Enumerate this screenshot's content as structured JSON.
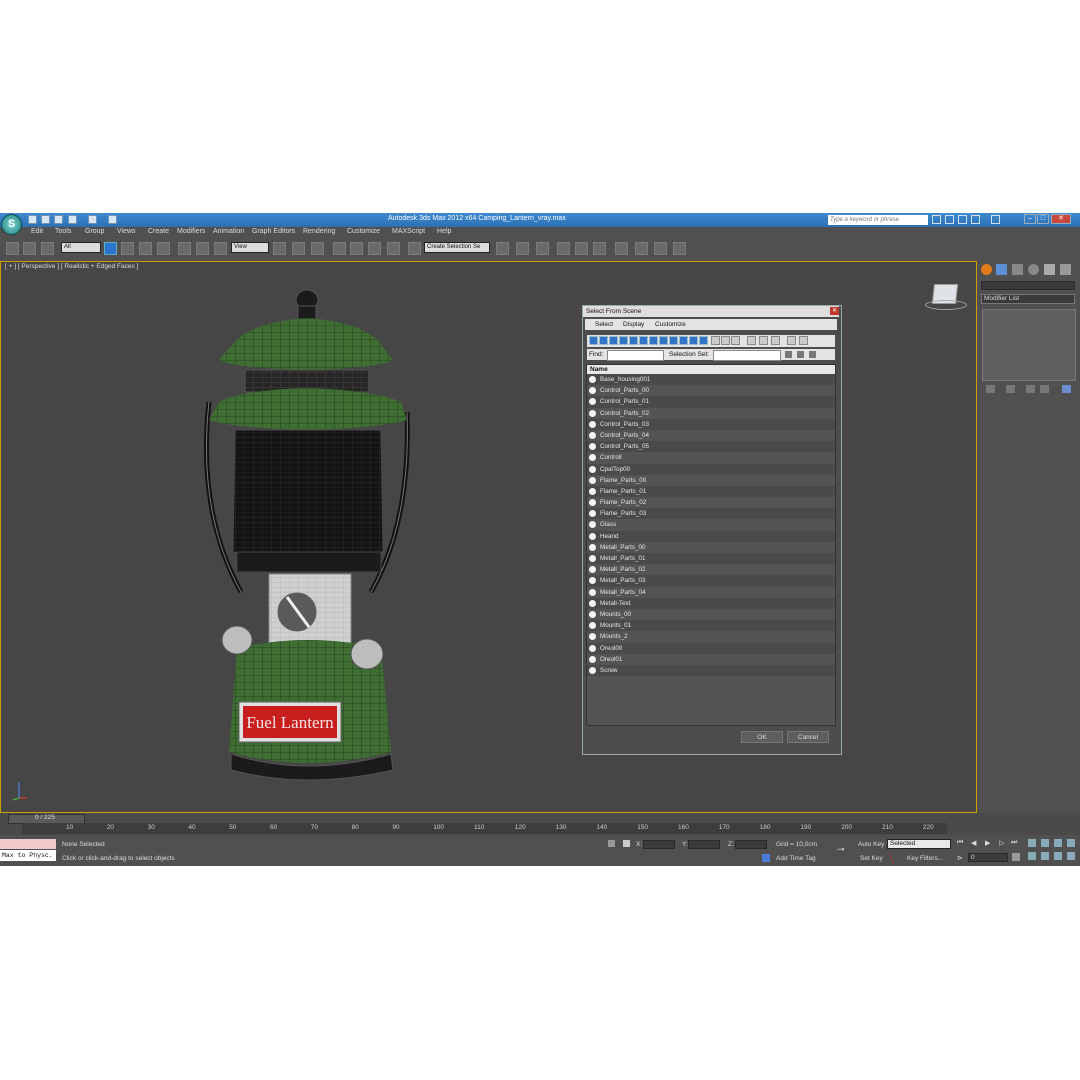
{
  "window": {
    "title": "Autodesk 3ds Max  2012 x64     Camping_Lantern_vray.max",
    "search_placeholder": "Type a keyword or phrase"
  },
  "menu": [
    "Edit",
    "Tools",
    "Group",
    "Views",
    "Create",
    "Modifiers",
    "Animation",
    "Graph Editors",
    "Rendering",
    "Customize",
    "MAXScript",
    "Help"
  ],
  "toolbar": {
    "selection_filter": "All",
    "reference_coord": "View",
    "named_selection_set": "Create Selection Se"
  },
  "viewport": {
    "label": "[ + ] [ Perspective ] [ Realistic + Edged Faces ]",
    "model_label": "Fuel Lantern"
  },
  "command_panel": {
    "modifier_list": "Modifier List"
  },
  "dialog": {
    "title": "Select From Scene",
    "menus": [
      "Select",
      "Display",
      "Customize"
    ],
    "find_label": "Find:",
    "selection_set_label": "Selection Set:",
    "column_name": "Name",
    "items": [
      "Base_housing001",
      "Control_Parts_00",
      "Control_Parts_01",
      "Control_Parts_02",
      "Control_Parts_03",
      "Control_Parts_04",
      "Control_Parts_05",
      "Controll",
      "CpalTop00",
      "Flame_Parts_00",
      "Flame_Parts_01",
      "Flame_Parts_02",
      "Flame_Parts_03",
      "Glass",
      "Heand",
      "Metall_Parts_00",
      "Metall_Parts_01",
      "Metall_Parts_02",
      "Metall_Parts_03",
      "Metall_Parts_04",
      "Metall-Text",
      "Mounts_00",
      "Mounts_01",
      "Mounts_2",
      "Oreol00",
      "Oreol01",
      "Screw"
    ],
    "ok": "OK",
    "cancel": "Cancel"
  },
  "timeline": {
    "frame": "0 / 225",
    "ticks": [
      "10",
      "20",
      "30",
      "40",
      "50",
      "60",
      "70",
      "80",
      "90",
      "100",
      "110",
      "120",
      "130",
      "140",
      "150",
      "160",
      "170",
      "180",
      "190",
      "200",
      "210",
      "220"
    ]
  },
  "status": {
    "maxscript": "Max to Physc.",
    "selection": "None Selected",
    "prompt": "Click or click-and-drag to select objects",
    "x_label": "X:",
    "y_label": "Y:",
    "z_label": "Z:",
    "grid": "Grid = 10,0cm",
    "add_time_tag": "Add Time Tag",
    "auto_key": "Auto Key",
    "set_key": "Set Key",
    "key_mode": "Selected",
    "key_filters": "Key Filters...",
    "frame_value": "0"
  }
}
